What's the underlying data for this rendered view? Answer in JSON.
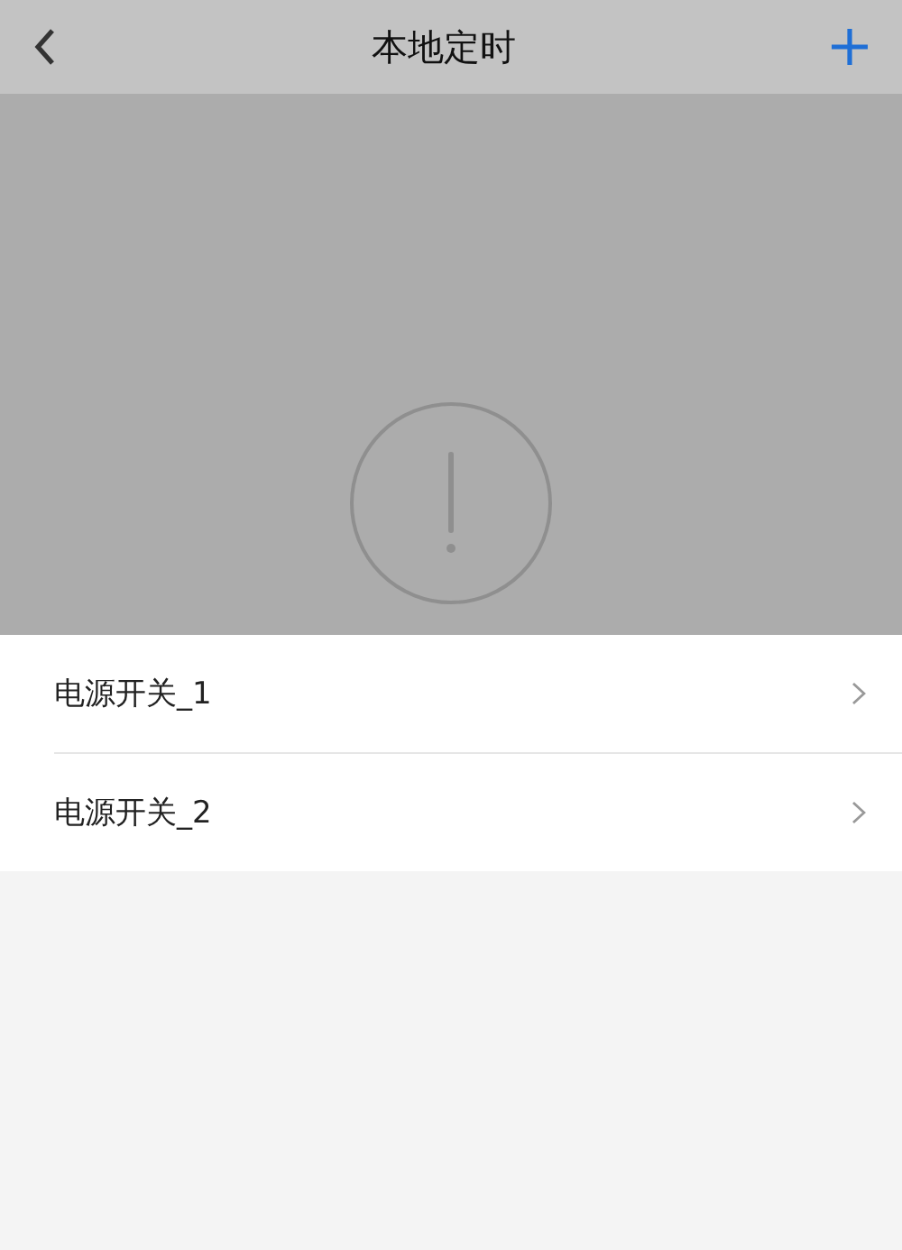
{
  "header": {
    "title": "本地定时"
  },
  "items": [
    {
      "label": "电源开关_1"
    },
    {
      "label": "电源开关_2"
    }
  ]
}
